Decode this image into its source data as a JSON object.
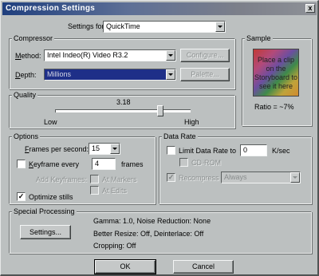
{
  "window": {
    "title": "Compression Settings",
    "close": "x"
  },
  "settings_for": {
    "label": "Settings for:",
    "value": "QuickTime"
  },
  "compressor": {
    "title": "Compressor",
    "method_label": "Method:",
    "method_value": "Intel Indeo(R) Video R3.2",
    "configure_label": "Configure...",
    "depth_label": "Depth:",
    "depth_value": "Millions",
    "palette_label": "Palette..."
  },
  "sample": {
    "title": "Sample",
    "preview_text": "Place a clip on the Storyboard to see it here",
    "ratio": "Ratio = ~7%"
  },
  "quality": {
    "title": "Quality",
    "value": "3.18",
    "level": 0.79,
    "low_label": "Low",
    "high_label": "High"
  },
  "options": {
    "title": "Options",
    "fps_label": "Frames per second:",
    "fps_value": "15",
    "keyframe_label": "Keyframe every",
    "keyframe_value": "4",
    "keyframe_unit": "frames",
    "keyframe_checked": false,
    "add_keyframes_label": "Add Keyframes:",
    "at_markers_label": "At Markers",
    "at_edits_label": "At Edits",
    "optimize_label": "Optimize stills",
    "optimize_checked": true
  },
  "data_rate": {
    "title": "Data Rate",
    "limit_label": "Limit Data Rate to",
    "limit_value": "0",
    "limit_unit": "K/sec",
    "cdrom_label": "CD-ROM",
    "recompress_label": "Recompress",
    "recompress_value": "Always",
    "recompress_checked": true
  },
  "special_processing": {
    "title": "Special Processing",
    "settings_button": "Settings...",
    "line1": "Gamma: 1.0, Noise Reduction: None",
    "line2": "Better Resize: Off, Deinterlace: Off",
    "line3": "Cropping: Off"
  },
  "footer": {
    "ok_label": "OK",
    "cancel_label": "Cancel"
  }
}
